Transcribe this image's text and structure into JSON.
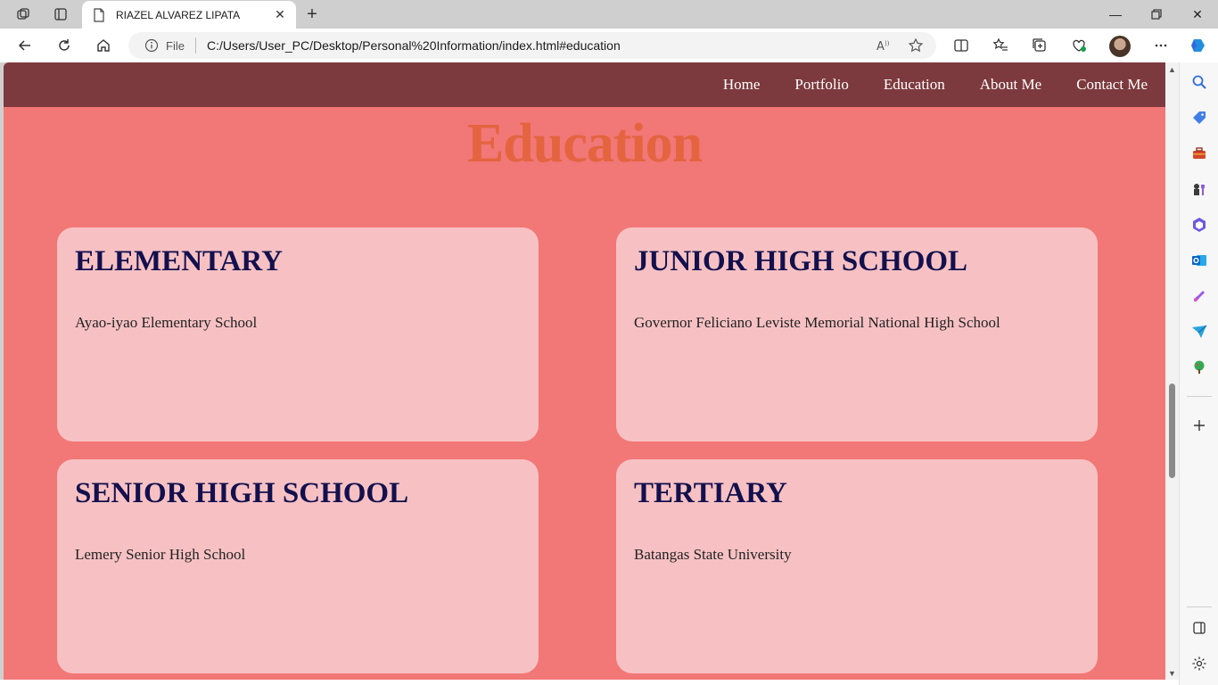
{
  "browser": {
    "tab_title": "RIAZEL ALVAREZ LIPATA",
    "file_label": "File",
    "url": "C:/Users/User_PC/Desktop/Personal%20Information/index.html#education"
  },
  "nav": {
    "items": [
      "Home",
      "Portfolio",
      "Education",
      "About Me",
      "Contact Me"
    ]
  },
  "page": {
    "heading": "Education",
    "cards": [
      {
        "title": "ELEMENTARY",
        "school": "Ayao-iyao Elementary School"
      },
      {
        "title": "JUNIOR HIGH SCHOOL",
        "school": "Governor Feliciano Leviste Memorial National High School"
      },
      {
        "title": "SENIOR HIGH SCHOOL",
        "school": "Lemery Senior High School"
      },
      {
        "title": "TERTIARY",
        "school": "Batangas State University"
      }
    ]
  },
  "colors": {
    "nav_bg": "#7d3a3e",
    "page_bg": "#f27777",
    "heading": "#e3643f",
    "card_bg": "#f7c1c3",
    "card_title": "#13104e"
  },
  "icons": {
    "sidebar": [
      "search-icon",
      "tag-icon",
      "toolbox-icon",
      "chess-icon",
      "office-icon",
      "outlook-icon",
      "designer-icon",
      "send-icon",
      "tree-icon",
      "add-icon",
      "sidebar-toggle-icon",
      "settings-icon"
    ]
  }
}
